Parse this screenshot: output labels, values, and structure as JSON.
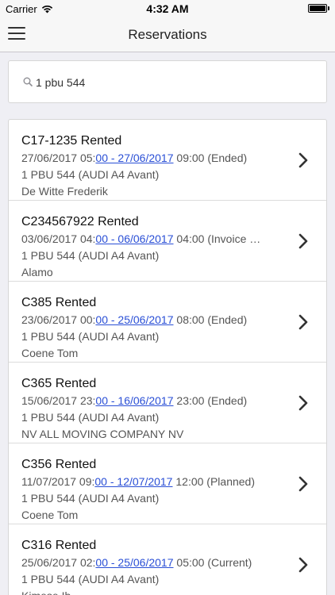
{
  "status_bar": {
    "carrier": "Carrier",
    "time": "4:32 AM"
  },
  "nav": {
    "title": "Reservations"
  },
  "search": {
    "value": "1 pbu 544"
  },
  "reservations": [
    {
      "title": "C17-1235 Rented",
      "date_start": "27/06/2017 05:",
      "date_link": "00 - 27/06/2017",
      "date_end": " 09:00 (Ended)",
      "vehicle": "1 PBU 544 (AUDI A4 Avant)",
      "customer": "De Witte Frederik"
    },
    {
      "title": "C234567922 Rented",
      "date_start": "03/06/2017 04:",
      "date_link": "00 - 06/06/2017",
      "date_end": " 04:00 (Invoice …",
      "vehicle": "1 PBU 544 (AUDI A4 Avant)",
      "customer": "Alamo"
    },
    {
      "title": "C385 Rented",
      "date_start": "23/06/2017 00:",
      "date_link": "00 - 25/06/2017",
      "date_end": " 08:00 (Ended)",
      "vehicle": "1 PBU 544 (AUDI A4 Avant)",
      "customer": "Coene Tom"
    },
    {
      "title": "C365 Rented",
      "date_start": "15/06/2017 23:",
      "date_link": "00 - 16/06/2017",
      "date_end": " 23:00 (Ended)",
      "vehicle": "1 PBU 544 (AUDI A4 Avant)",
      "customer": "NV ALL MOVING COMPANY NV"
    },
    {
      "title": "C356 Rented",
      "date_start": "11/07/2017 09:",
      "date_link": "00 - 12/07/2017",
      "date_end": " 12:00 (Planned)",
      "vehicle": "1 PBU 544 (AUDI A4 Avant)",
      "customer": "Coene Tom"
    },
    {
      "title": "C316 Rented",
      "date_start": "25/06/2017 02:",
      "date_link": "00 - 25/06/2017",
      "date_end": " 05:00 (Current)",
      "vehicle": "1 PBU 544 (AUDI A4 Avant)",
      "customer": "Kimese Ib"
    }
  ],
  "colors": {
    "link": "#2a4fd6",
    "background": "#efeff4"
  },
  "icons": {
    "wifi": "wifi-icon",
    "battery": "battery-icon",
    "menu": "hamburger-menu-icon",
    "search": "search-icon",
    "chevron": "chevron-right-icon"
  }
}
